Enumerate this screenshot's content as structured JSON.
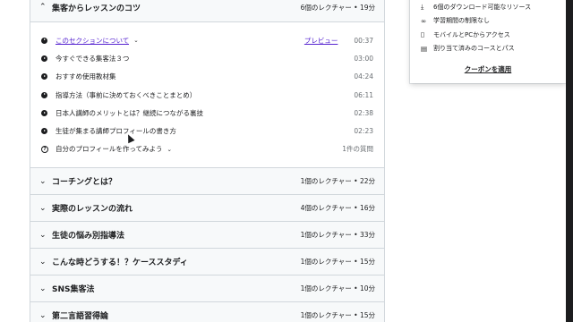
{
  "sections": [
    {
      "title": "集客からレッスンのコツ",
      "meta": "6個のレクチャー • 19分",
      "expanded": true,
      "lectures": [
        {
          "type": "play",
          "name": "このセクションについて",
          "link": true,
          "chevron": true,
          "preview": "プレビュー",
          "duration": "00:37"
        },
        {
          "type": "play",
          "name": "今すぐできる集客法３つ",
          "duration": "03:00"
        },
        {
          "type": "play",
          "name": "おすすめ使用教材集",
          "duration": "04:24"
        },
        {
          "type": "play",
          "name": "指導方法（事前に決めておくべきことまとめ）",
          "duration": "06:11"
        },
        {
          "type": "play",
          "name": "日本人講師のメリットとは？継続につながる裏技",
          "duration": "02:38"
        },
        {
          "type": "play",
          "name": "生徒が集まる講師プロフィールの書き方",
          "duration": "02:23"
        },
        {
          "type": "quiz",
          "name": "自分のプロフィールを作ってみよう",
          "chevron": true,
          "duration": "1件の質問"
        }
      ]
    },
    {
      "title": "コーチングとは？",
      "meta": "1個のレクチャー • 22分"
    },
    {
      "title": "実際のレッスンの流れ",
      "meta": "4個のレクチャー • 16分"
    },
    {
      "title": "生徒の悩み別指導法",
      "meta": "1個のレクチャー • 33分"
    },
    {
      "title": "こんな時どうする！？ケーススタディ",
      "meta": "1個のレクチャー • 15分"
    },
    {
      "title": "SNS集客法",
      "meta": "1個のレクチャー • 10分"
    },
    {
      "title": "第二言語習得論",
      "meta": "1個のレクチャー • 15分"
    }
  ],
  "sidebar": {
    "features": [
      {
        "icon": "download-icon",
        "glyph": "⤓",
        "text": "6個のダウンロード可能なリソース"
      },
      {
        "icon": "infinity-icon",
        "glyph": "∞",
        "text": "学習期間の制限なし"
      },
      {
        "icon": "mobile-icon",
        "glyph": "▯",
        "text": "モバイルとPCからアクセス"
      },
      {
        "icon": "assignment-icon",
        "glyph": "▤",
        "text": "割り当て済みのコースとパス"
      }
    ],
    "coupon_label": "クーポンを適用"
  },
  "colors": {
    "link": "#5624d0",
    "border": "#d1d7dc",
    "section_bg": "#f7f9fa"
  }
}
